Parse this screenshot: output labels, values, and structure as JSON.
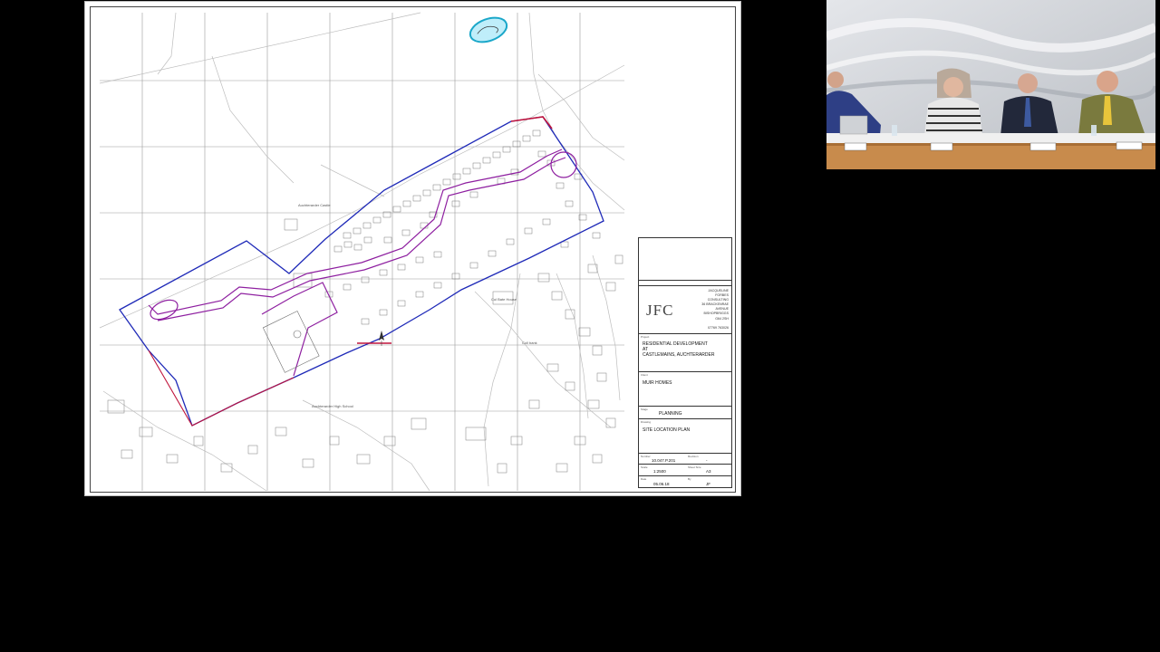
{
  "plan": {
    "road_labels": {
      "cottage_label": "Auchterarder Castle",
      "high_school": "Auchterarder High School",
      "east_label": "Cul Bate House",
      "south_label": "Coll bank"
    },
    "title_block": {
      "logo": "JFC",
      "firm_lines": [
        "JACQUELINE",
        "FORBES",
        "CONSULTING",
        "36 BRACKENRAE",
        "AVENUE",
        "BISHOPBRIGGS",
        "G64 2SH",
        "",
        "07769 763026"
      ],
      "project_tag": "Project",
      "project_line1": "RESIDENTIAL DEVELOPMENT",
      "project_line2": "AT",
      "project_line3": "CASTLEMAINS, AUCHTERARDER",
      "client_tag": "Client",
      "client": "MUIR HOMES",
      "stage_tag": "Stage",
      "stage": "PLANNING",
      "drawing_tag": "Drawing",
      "drawing": "SITE LOCATION PLAN",
      "number_tag": "Number",
      "number": "10.047.P.201",
      "revision_tag": "Revision",
      "revision": "-",
      "scale_tag": "Scale",
      "scale": "1:2500",
      "sheet_tag": "Sheet Size",
      "sheet": "A3",
      "date_tag": "Date",
      "date": "05.06.18",
      "by_tag": "By",
      "by": "JF"
    }
  },
  "colors": {
    "site_boundary": "#c0143c",
    "ownership_boundary": "#1f2ab8",
    "road_outline": "#8e1fa0",
    "pond": "#1aa7c9"
  }
}
